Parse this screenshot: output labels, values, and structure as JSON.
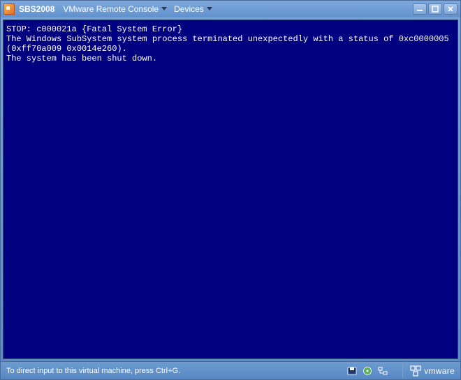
{
  "titlebar": {
    "vm_name": "SBS2008",
    "menu_console": "VMware Remote Console",
    "menu_devices": "Devices"
  },
  "console": {
    "line1": "STOP: c000021a {Fatal System Error}",
    "line2": "The Windows SubSystem system process terminated unexpectedly with a status of 0xc0000005 (0xff70a009 0x0014e260).",
    "line3": "The system has been shut down."
  },
  "statusbar": {
    "hint": "To direct input to this virtual machine, press Ctrl+G.",
    "logo_text": "vmware"
  }
}
